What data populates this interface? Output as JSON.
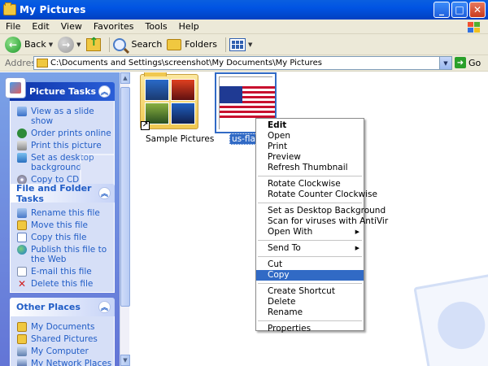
{
  "window": {
    "title": "My Pictures"
  },
  "menubar": [
    "File",
    "Edit",
    "View",
    "Favorites",
    "Tools",
    "Help"
  ],
  "toolbar": {
    "back": "Back",
    "search": "Search",
    "folders": "Folders"
  },
  "address": {
    "label": "Address",
    "path": "C:\\Documents and Settings\\screenshot\\My Documents\\My Pictures",
    "go": "Go"
  },
  "picture_tasks": {
    "title": "Picture Tasks",
    "items": [
      "View as a slide show",
      "Order prints online",
      "Print this picture",
      "Set as desktop background",
      "Copy to CD"
    ]
  },
  "file_tasks": {
    "title": "File and Folder Tasks",
    "items": [
      "Rename this file",
      "Move this file",
      "Copy this file",
      "Publish this file to the Web",
      "E-mail this file",
      "Delete this file"
    ]
  },
  "other_places": {
    "title": "Other Places",
    "items": [
      "My Documents",
      "Shared Pictures",
      "My Computer",
      "My Network Places"
    ]
  },
  "files": [
    {
      "name": "Sample Pictures",
      "icon": "folder-thumbnail-icon"
    },
    {
      "name": "us-flag.gif",
      "icon": "us-flag-thumbnail",
      "selected": true
    }
  ],
  "context_menu": {
    "items": [
      {
        "label": "Edit",
        "bold": true
      },
      {
        "label": "Open"
      },
      {
        "label": "Print"
      },
      {
        "label": "Preview"
      },
      {
        "label": "Refresh Thumbnail"
      },
      {
        "sep": true
      },
      {
        "label": "Rotate Clockwise"
      },
      {
        "label": "Rotate Counter Clockwise"
      },
      {
        "sep": true
      },
      {
        "label": "Set as Desktop Background"
      },
      {
        "label": "Scan for viruses with AntiVir"
      },
      {
        "label": "Open With",
        "submenu": true
      },
      {
        "sep": true
      },
      {
        "label": "Send To",
        "submenu": true
      },
      {
        "sep": true
      },
      {
        "label": "Cut"
      },
      {
        "label": "Copy",
        "highlighted": true
      },
      {
        "sep": true
      },
      {
        "label": "Create Shortcut"
      },
      {
        "label": "Delete"
      },
      {
        "label": "Rename"
      },
      {
        "sep": true
      },
      {
        "label": "Properties"
      }
    ]
  },
  "colors": {
    "titlebar": "#0054e3",
    "selection": "#316ac5",
    "taskpane": "#7ba2e7",
    "link": "#215dc6"
  }
}
